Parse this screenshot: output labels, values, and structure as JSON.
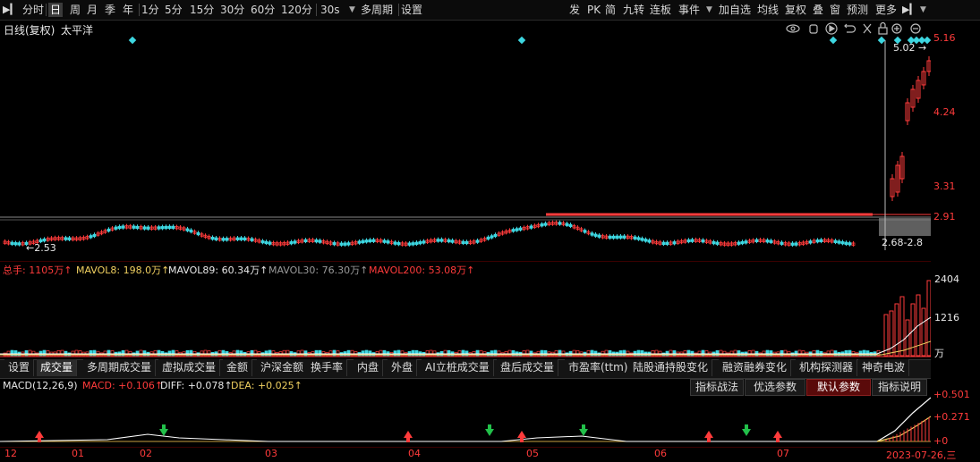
{
  "toolbar": {
    "left_items": [
      {
        "label": "分时",
        "active": false
      },
      {
        "label": "日",
        "active": true
      },
      {
        "label": "周",
        "active": false
      },
      {
        "label": "月",
        "active": false
      },
      {
        "label": "季",
        "active": false
      },
      {
        "label": "年",
        "active": false
      },
      {
        "label": "1分",
        "active": false
      },
      {
        "label": "5分",
        "active": false
      },
      {
        "label": "15分",
        "active": false
      },
      {
        "label": "30分",
        "active": false
      },
      {
        "label": "60分",
        "active": false
      },
      {
        "label": "120分",
        "active": false
      },
      {
        "label": "30s",
        "active": false
      },
      {
        "label": "多周期",
        "active": false
      },
      {
        "label": "设置",
        "active": false
      }
    ],
    "right_items": [
      "发",
      "PK",
      "简",
      "九转",
      "连板",
      "事件",
      "加自选",
      "均线",
      "复权",
      "叠",
      "窗",
      "预测",
      "更多"
    ]
  },
  "chart": {
    "title": "日线(复权)",
    "stock_name": "太平洋",
    "price_labels": [
      "5.16",
      "4.24",
      "3.31",
      "2.91"
    ],
    "high_marker": "5.02 →",
    "low_marker": "←2.53",
    "range_label": "2.68-2.8"
  },
  "volume": {
    "header": [
      {
        "text": "总手: 1105万↑",
        "color": "red"
      },
      {
        "text": "MAVOL8: 198.0万↑",
        "color": "yellow"
      },
      {
        "text": "MAVOL89: 60.34万↑",
        "color": "white"
      },
      {
        "text": "MAVOL30: 76.30万↑",
        "color": "gray"
      },
      {
        "text": "MAVOL200: 53.08万↑",
        "color": "red"
      }
    ],
    "axis": [
      "2404",
      "1216",
      "万"
    ]
  },
  "indicator_tabs": [
    "设置",
    "成交量",
    "多周期成交量",
    "虚拟成交量",
    "金额",
    "沪深金额",
    "换手率",
    "内盘",
    "外盘",
    "AI立桩成交量",
    "盘后成交量",
    "市盈率(ttm)",
    "陆股通持股变化",
    "融资融券变化",
    "机构探测器",
    "神奇电波"
  ],
  "macd": {
    "header": [
      {
        "text": "MACD(12,26,9)",
        "color": "white"
      },
      {
        "text": "MACD: +0.106↑",
        "color": "red"
      },
      {
        "text": "DIFF: +0.078↑",
        "color": "white"
      },
      {
        "text": "DEA: +0.025↑",
        "color": "yellow"
      }
    ],
    "buttons": [
      "指标战法",
      "优选参数",
      "默认参数",
      "指标说明"
    ],
    "axis": [
      "+0.501",
      "+0.271",
      "+0"
    ]
  },
  "x_axis": [
    "12",
    "01",
    "02",
    "03",
    "04",
    "05",
    "06",
    "07",
    "2023-07-26,三"
  ],
  "colors": {
    "up": "#ff3b3b",
    "down": "#3dd6e0",
    "ma": "#ffffff",
    "accent": "#ff2020"
  }
}
